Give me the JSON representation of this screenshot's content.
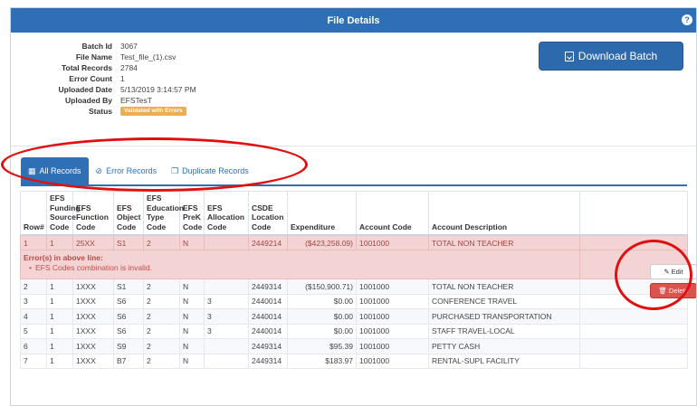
{
  "header": {
    "title": "File Details",
    "help_icon": "?"
  },
  "details": [
    {
      "label": "Batch Id",
      "value": "3067"
    },
    {
      "label": "File Name",
      "value": "Test_file_(1).csv"
    },
    {
      "label": "Total Records",
      "value": "2784"
    },
    {
      "label": "Error Count",
      "value": "1"
    },
    {
      "label": "Uploaded Date",
      "value": "5/13/2019 3:14:57 PM"
    },
    {
      "label": "Uploaded By",
      "value": "EFSTesT"
    }
  ],
  "status": {
    "label": "Status",
    "value": "Validated with Errors",
    "color": "#f0ad4e"
  },
  "download_button": {
    "label": "Download Batch"
  },
  "tabs": [
    {
      "label": "All Records",
      "icon": "grid-icon",
      "active": true
    },
    {
      "label": "Error Records",
      "icon": "ban-icon",
      "active": false
    },
    {
      "label": "Duplicate Records",
      "icon": "copy-icon",
      "active": false
    }
  ],
  "table": {
    "columns": [
      "Row#",
      "EFS Funding Source Code",
      "EFS Function Code",
      "EFS Object Code",
      "EFS Education Type Code",
      "EFS PreK Code",
      "EFS Allocation Code",
      "CSDE Location Code",
      "Expenditure",
      "Account Code",
      "Account Description",
      ""
    ],
    "rows": [
      [
        "1",
        "1",
        "25XX",
        "S1",
        "2",
        "N",
        "",
        "2449214",
        "($423,258.09)",
        "1001000",
        "TOTAL NON TEACHER"
      ],
      [
        "2",
        "1",
        "1XXX",
        "S1",
        "2",
        "N",
        "",
        "2449314",
        "($150,900.71)",
        "1001000",
        "TOTAL NON TEACHER"
      ],
      [
        "3",
        "1",
        "1XXX",
        "S6",
        "2",
        "N",
        "3",
        "2440014",
        "$0.00",
        "1001000",
        "CONFERENCE TRAVEL"
      ],
      [
        "4",
        "1",
        "1XXX",
        "S6",
        "2",
        "N",
        "3",
        "2440014",
        "$0.00",
        "1001000",
        "PURCHASED TRANSPORTATION"
      ],
      [
        "5",
        "1",
        "1XXX",
        "S6",
        "2",
        "N",
        "3",
        "2440014",
        "$0.00",
        "1001000",
        "STAFF TRAVEL-LOCAL"
      ],
      [
        "6",
        "1",
        "1XXX",
        "S9",
        "2",
        "N",
        "",
        "2449314",
        "$95.39",
        "1001000",
        "PETTY CASH"
      ],
      [
        "7",
        "1",
        "1XXX",
        "B7",
        "2",
        "N",
        "",
        "2449314",
        "$183.97",
        "1001000",
        "RENTAL-SUPL FACILITY"
      ]
    ],
    "error": {
      "title": "Error(s) in above line:",
      "items": [
        "EFS Codes combination is invalid."
      ]
    }
  },
  "row_actions": {
    "edit_label": "Edit",
    "delete_label": "Delete"
  },
  "colors": {
    "header": "#2e6fb5",
    "error_bg": "#f3d3d3",
    "delete": "#d9534f",
    "annotation": "#e01010"
  }
}
